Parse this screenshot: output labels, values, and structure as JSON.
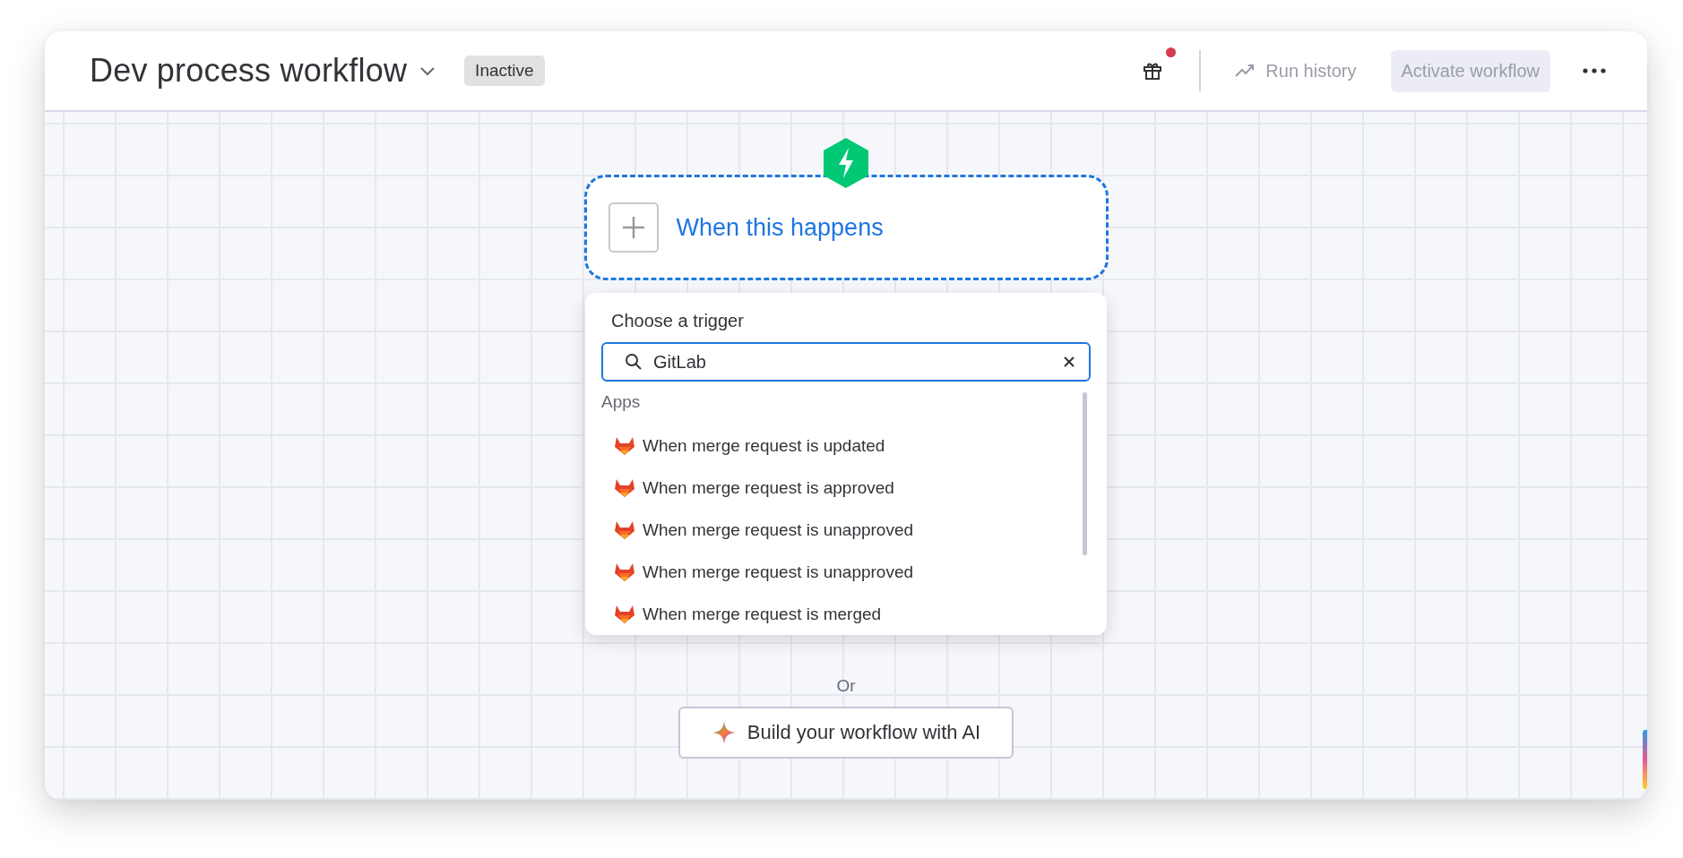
{
  "header": {
    "title": "Dev process workflow",
    "status": "Inactive",
    "notification": true,
    "run_history": "Run history",
    "activate_button": {
      "label": "Activate workflow",
      "disabled": true
    }
  },
  "trigger_card": {
    "label": "When this happens",
    "focused": true
  },
  "trigger_picker": {
    "title": "Choose a trigger",
    "search": {
      "value": "GitLab"
    },
    "section": "Apps",
    "items": [
      {
        "label": "When merge request is updated"
      },
      {
        "label": "When merge request is approved"
      },
      {
        "label": "When merge request is unapproved"
      },
      {
        "label": "When merge request is unapproved"
      },
      {
        "label": "When merge request is merged"
      }
    ]
  },
  "divider_text": "Or",
  "ai_button": {
    "label": "Build your workflow with AI"
  }
}
